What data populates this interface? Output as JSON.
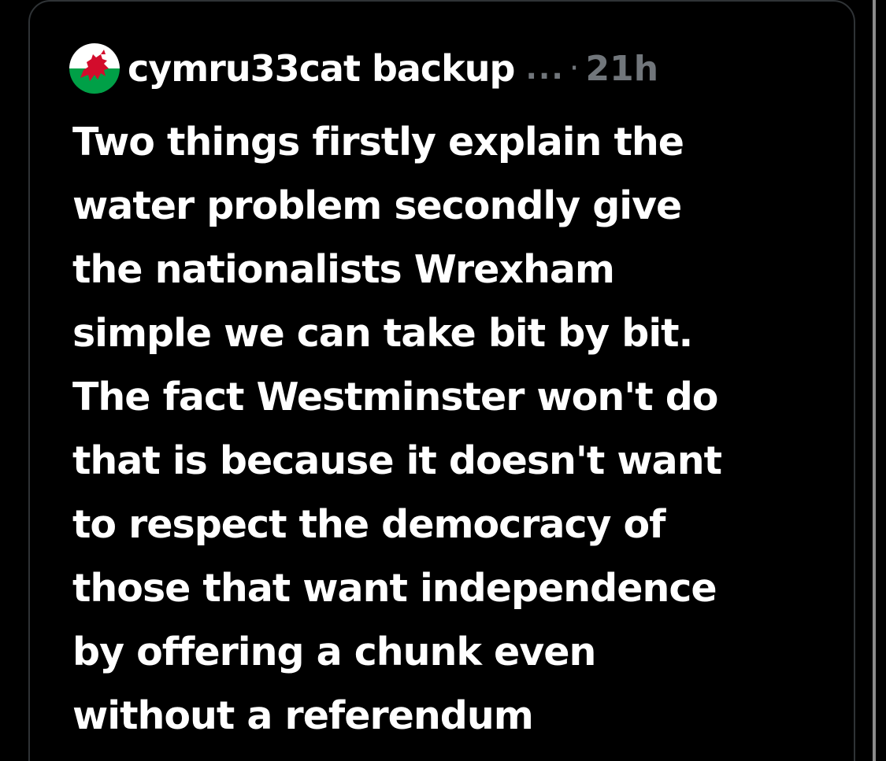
{
  "post": {
    "author": "cymru33cat backup",
    "more": "...",
    "separator": "·",
    "time": "21h",
    "avatar_icon": "welsh-dragon-flag-icon",
    "text_lines": [
      "Two things firstly explain the",
      "water problem secondly give",
      "the nationalists Wrexham",
      "simple we can take bit by bit.",
      "The fact Westminster won't do",
      "that is because it doesn't want",
      "to respect the democracy of",
      "those that want independence",
      "by offering a chunk even",
      "without a referendum"
    ]
  },
  "colors": {
    "background": "#000000",
    "text": "#ffffff",
    "secondary": "#71767b",
    "border": "#2f3336",
    "flag_white": "#ffffff",
    "flag_green": "#00a047",
    "dragon_red": "#d30c2c"
  }
}
